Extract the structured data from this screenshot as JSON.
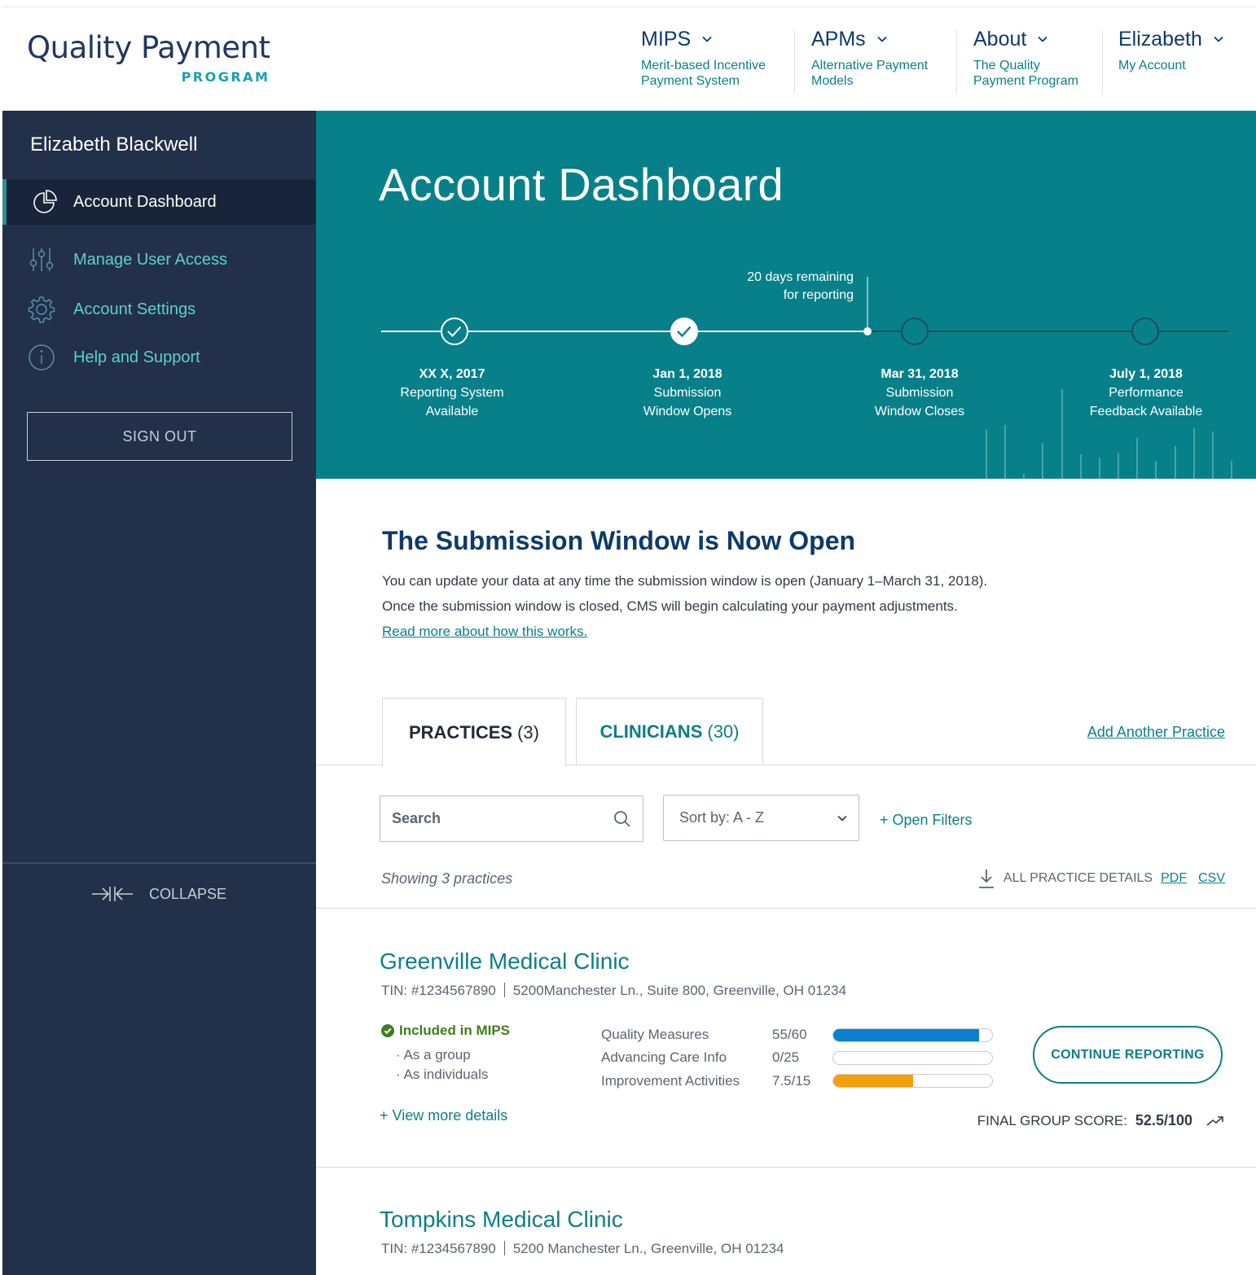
{
  "header": {
    "logo_main": "Quality Payment",
    "logo_sub": "PROGRAM",
    "nav": [
      {
        "title": "MIPS",
        "sub1": "Merit-based Incentive",
        "sub2": "Payment System"
      },
      {
        "title": "APMs",
        "sub1": "Alternative Payment",
        "sub2": "Models"
      },
      {
        "title": "About",
        "sub1": "The Quality",
        "sub2": "Payment Program"
      },
      {
        "title": "Elizabeth",
        "sub1": "My Account",
        "sub2": ""
      }
    ]
  },
  "sidebar": {
    "user_name": "Elizabeth Blackwell",
    "items": [
      {
        "label": "Account Dashboard",
        "icon": "pie-chart-icon",
        "active": true
      },
      {
        "label": "Manage User Access",
        "icon": "sliders-icon",
        "active": false
      },
      {
        "label": "Account Settings",
        "icon": "gear-icon",
        "active": false
      },
      {
        "label": "Help and Support",
        "icon": "info-icon",
        "active": false
      }
    ],
    "sign_out": "SIGN OUT",
    "collapse": "COLLAPSE"
  },
  "hero": {
    "title": "Account Dashboard",
    "remaining_line1": "20 days remaining",
    "remaining_line2": "for reporting",
    "milestones": [
      {
        "date": "XX X, 2017",
        "line1": "Reporting System",
        "line2": "Available",
        "done": true
      },
      {
        "date": "Jan 1, 2018",
        "line1": "Submission",
        "line2": "Window Opens",
        "done": true
      },
      {
        "date": "Mar 31, 2018",
        "line1": "Submission",
        "line2": "Window Closes",
        "done": false
      },
      {
        "date": "July 1, 2018",
        "line1": "Performance",
        "line2": "Feedback Available",
        "done": false
      }
    ]
  },
  "notice": {
    "title": "The Submission Window is Now Open",
    "body": "You can update your data at any time the submission window is open (January 1–March 31, 2018). Once the submission window is closed, CMS will begin calculating your payment adjustments.",
    "link": "Read more about how this works."
  },
  "tabs": {
    "practices_label": "PRACTICES",
    "practices_count": "(3)",
    "clinicians_label": "CLINICIANS",
    "clinicians_count": "(30)",
    "add_practice": "Add Another Practice"
  },
  "controls": {
    "search_placeholder": "Search",
    "sort_label": "Sort by: A - Z",
    "open_filters": "+ Open Filters",
    "showing": "Showing 3 practices",
    "export_label": "ALL PRACTICE DETAILS",
    "pdf": "PDF",
    "csv": "CSV"
  },
  "practices": [
    {
      "name": "Greenville Medical Clinic",
      "tin": "TIN: #1234567890",
      "address": "5200Manchester Ln., Suite 800, Greenville, OH 01234",
      "status": "Included in MIPS",
      "status_items": [
        "As a group",
        "As individuals"
      ],
      "view_more": "+ View more details",
      "metrics": [
        {
          "label": "Quality Measures",
          "value": "55/60",
          "fraction": 0.917,
          "color": "#0a7fce"
        },
        {
          "label": "Advancing Care Info",
          "value": "0/25",
          "fraction": 0,
          "color": "#0a7fce"
        },
        {
          "label": "Improvement Activities",
          "value": "7.5/15",
          "fraction": 0.5,
          "color": "#f5a00a"
        }
      ],
      "cta": "CONTINUE REPORTING",
      "score_label": "FINAL GROUP SCORE:",
      "score_value": "52.5/100"
    },
    {
      "name": "Tompkins Medical Clinic",
      "tin": "TIN: #1234567890",
      "address": "5200 Manchester Ln., Greenville, OH 01234"
    }
  ]
}
